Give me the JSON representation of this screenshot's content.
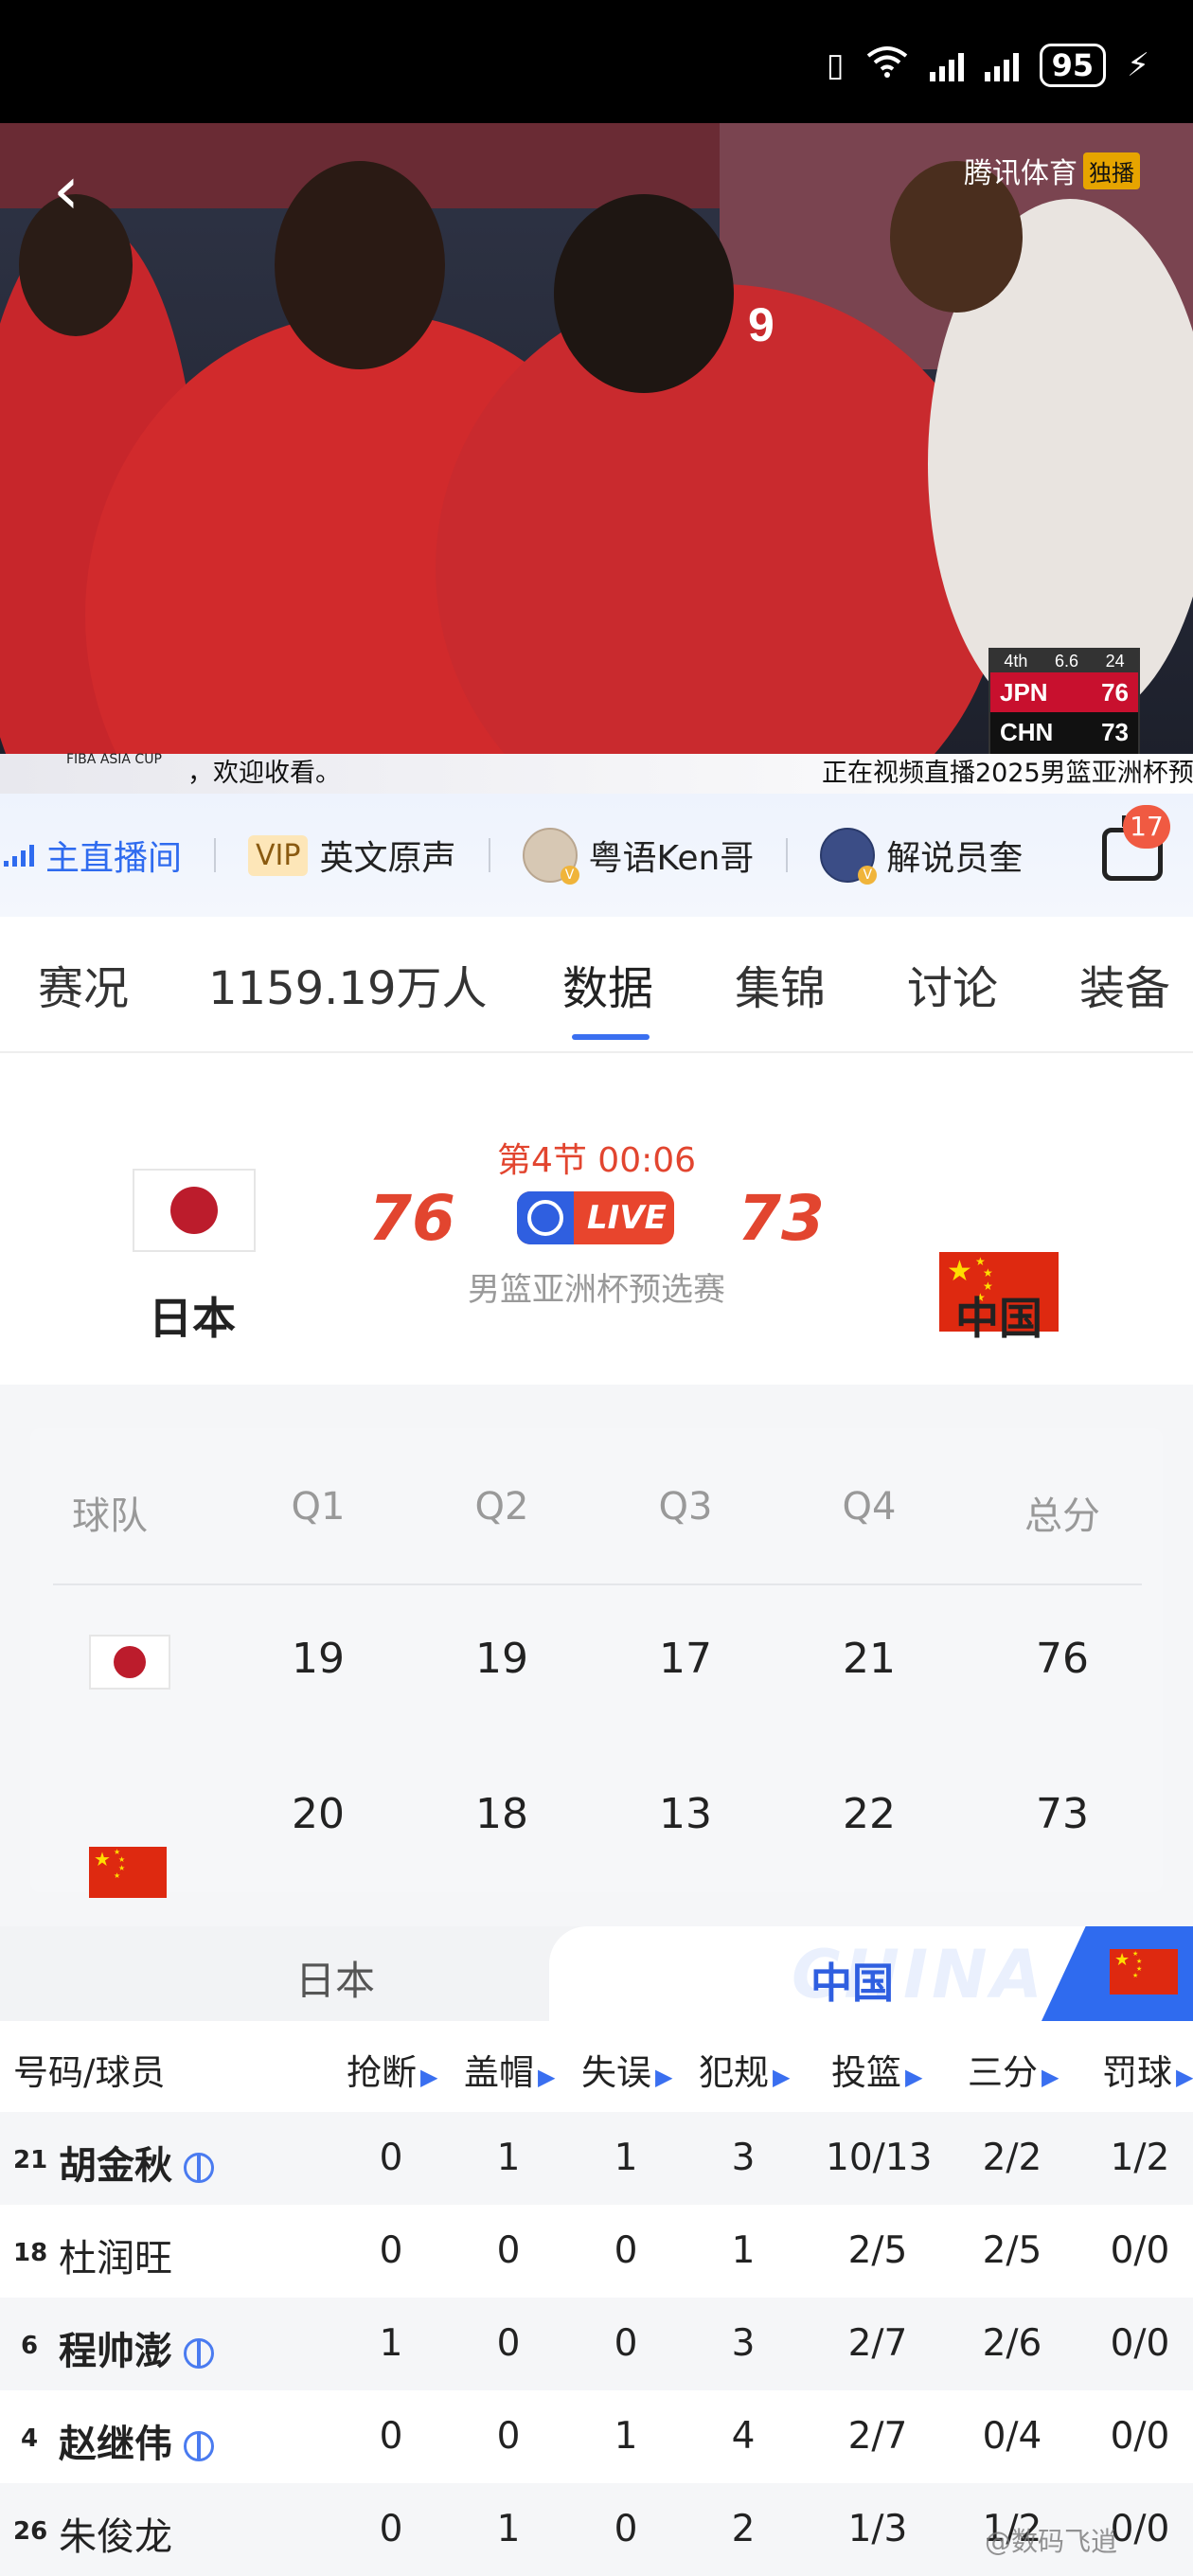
{
  "status_bar": {
    "battery": "95"
  },
  "video": {
    "broadcaster": "腾讯体育",
    "exclusive_badge": "独播",
    "ticker_left": "，欢迎收看。",
    "ticker_right": "正在视频直播2025男篮亚洲杯预",
    "event_logo": "FIBA ASIA CUP",
    "bug": {
      "period": "4th",
      "clock": "6.6",
      "shot_clock": "24",
      "team1": "JPN",
      "score1": "76",
      "team2": "CHN",
      "score2": "73"
    }
  },
  "channels": [
    {
      "label": "主直播间",
      "active": true
    },
    {
      "badge": "VIP",
      "label": "英文原声"
    },
    {
      "label": "粤语Ken哥"
    },
    {
      "label": "解说员奎"
    }
  ],
  "notification_count": "17",
  "tabs": [
    "赛况",
    "1159.19万人",
    "数据",
    "集锦",
    "讨论",
    "装备"
  ],
  "active_tab": "数据",
  "match": {
    "period_clock": "第4节 00:06",
    "live_label": "LIVE",
    "home": {
      "name": "日本",
      "score": "76"
    },
    "away": {
      "name": "中国",
      "score": "73"
    },
    "competition": "男篮亚洲杯预选赛"
  },
  "quarter_table": {
    "headers": [
      "球队",
      "Q1",
      "Q2",
      "Q3",
      "Q4",
      "总分"
    ],
    "rows": [
      {
        "team": "日本",
        "scores": [
          "19",
          "19",
          "17",
          "21",
          "76"
        ]
      },
      {
        "team": "中国",
        "scores": [
          "20",
          "18",
          "13",
          "22",
          "73"
        ]
      }
    ]
  },
  "team_toggle": {
    "left": "日本",
    "right": "中国",
    "watermark": "CHINA",
    "selected": "中国"
  },
  "player_table": {
    "headers": [
      "号码/球员",
      "抢断",
      "盖帽",
      "失误",
      "犯规",
      "投篮",
      "三分",
      "罚球"
    ],
    "rows": [
      {
        "number": "21",
        "name": "胡金秋",
        "starter": true,
        "stats": [
          "0",
          "1",
          "1",
          "3",
          "10/13",
          "2/2",
          "1/2"
        ]
      },
      {
        "number": "18",
        "name": "杜润旺",
        "starter": false,
        "stats": [
          "0",
          "0",
          "0",
          "1",
          "2/5",
          "2/5",
          "0/0"
        ]
      },
      {
        "number": "6",
        "name": "程帅澎",
        "starter": true,
        "stats": [
          "1",
          "0",
          "0",
          "3",
          "2/7",
          "2/6",
          "0/0"
        ]
      },
      {
        "number": "4",
        "name": "赵继伟",
        "starter": true,
        "stats": [
          "0",
          "0",
          "1",
          "4",
          "2/7",
          "0/4",
          "0/0"
        ]
      },
      {
        "number": "26",
        "name": "朱俊龙",
        "starter": false,
        "stats": [
          "0",
          "1",
          "0",
          "2",
          "1/3",
          "1/2",
          "0/0"
        ]
      }
    ]
  },
  "watermark": "@数码飞逍"
}
